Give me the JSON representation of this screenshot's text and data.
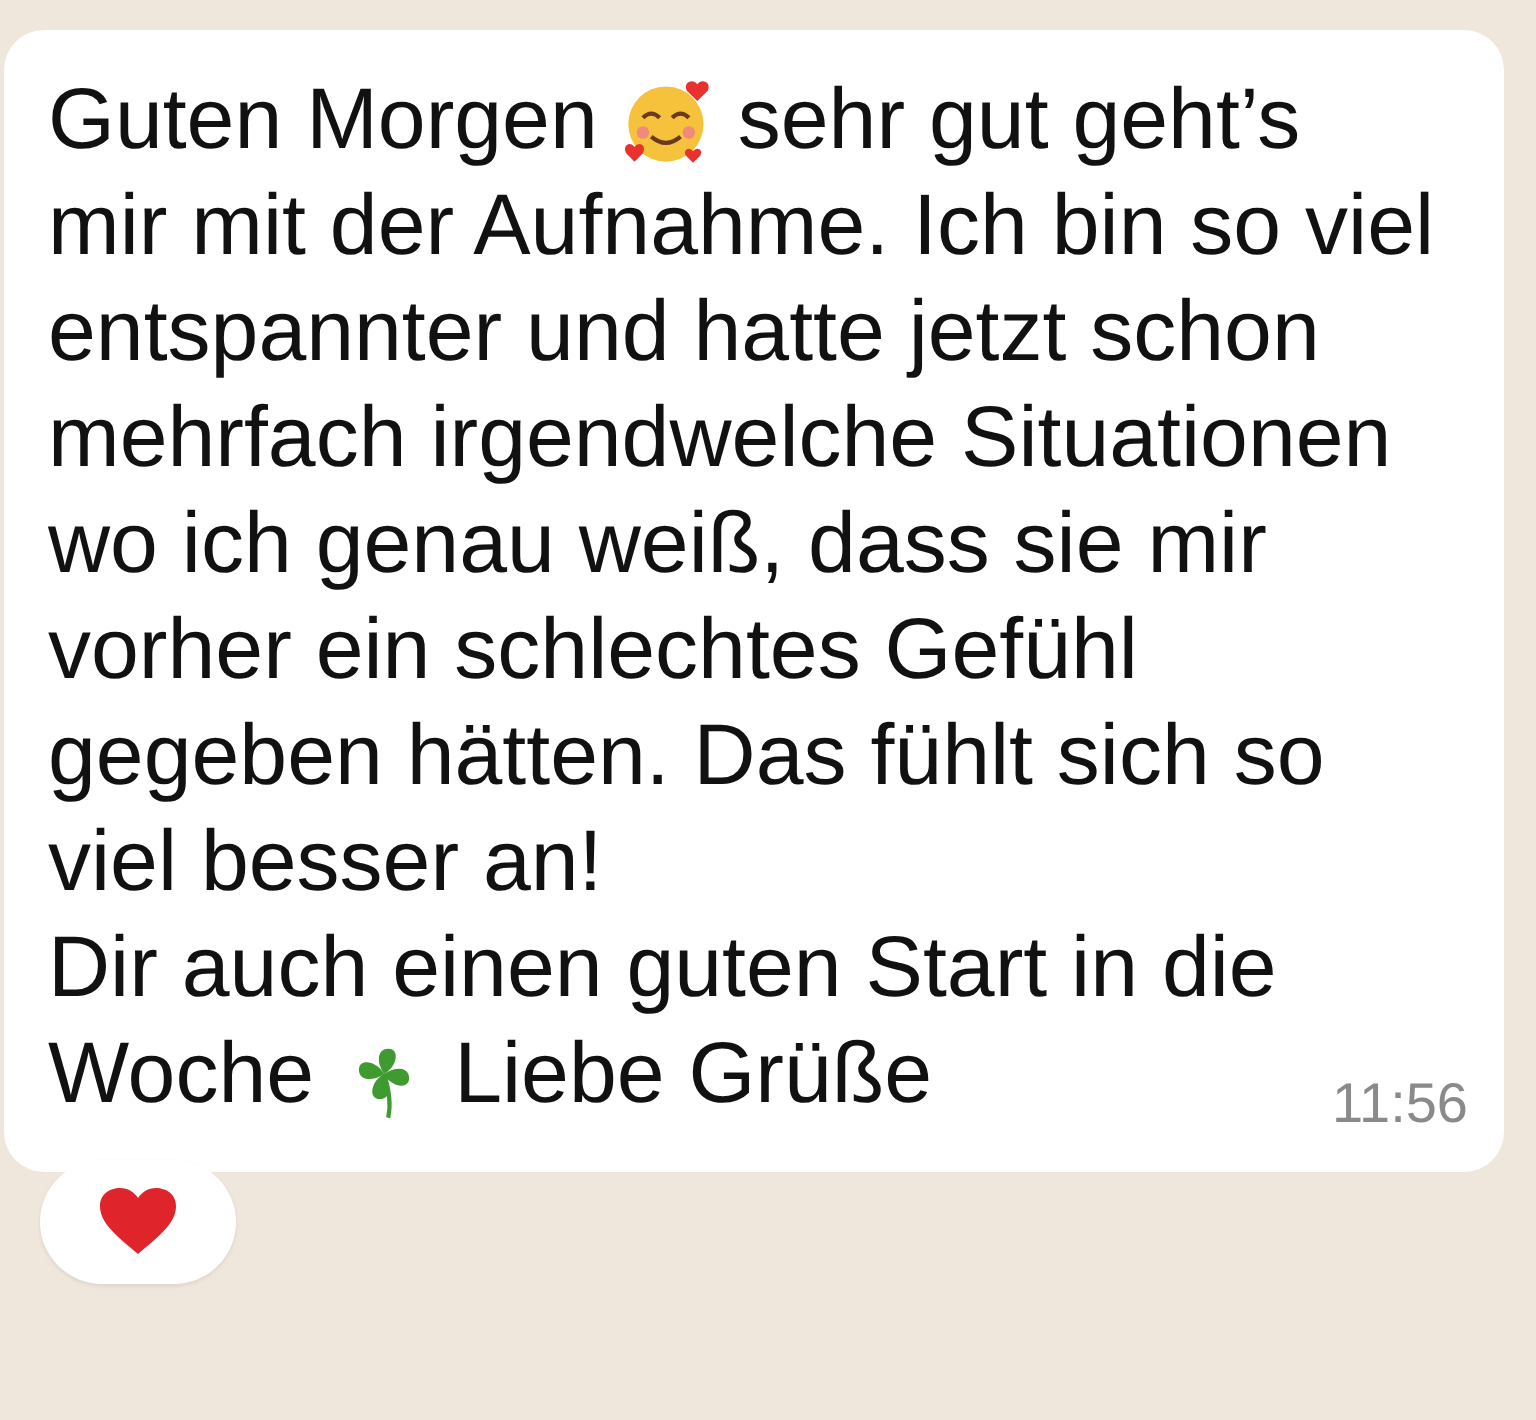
{
  "message": {
    "rows": [
      {
        "segments": [
          {
            "kind": "text",
            "text": "Guten Morgen"
          },
          {
            "kind": "smiley"
          },
          {
            "kind": "text",
            "text": "sehr gut geht’s"
          }
        ]
      },
      {
        "segments": [
          {
            "kind": "text",
            "text": "mir mit der Aufnahme. Ich bin so viel entspannter und hatte jetzt schon mehrfach irgendwelche Situationen wo ich genau weiß, dass sie mir vorher ein schlechtes Gefühl gegeben hätten. Das fühlt sich so viel besser an!\nDir auch einen guten Start in die"
          }
        ]
      },
      {
        "segments": [
          {
            "kind": "text",
            "text": "Woche"
          },
          {
            "kind": "clover"
          },
          {
            "kind": "text",
            "text": "Liebe Grüße"
          }
        ]
      }
    ],
    "time": "11:56"
  },
  "reactions": [
    {
      "kind": "heart"
    }
  ]
}
